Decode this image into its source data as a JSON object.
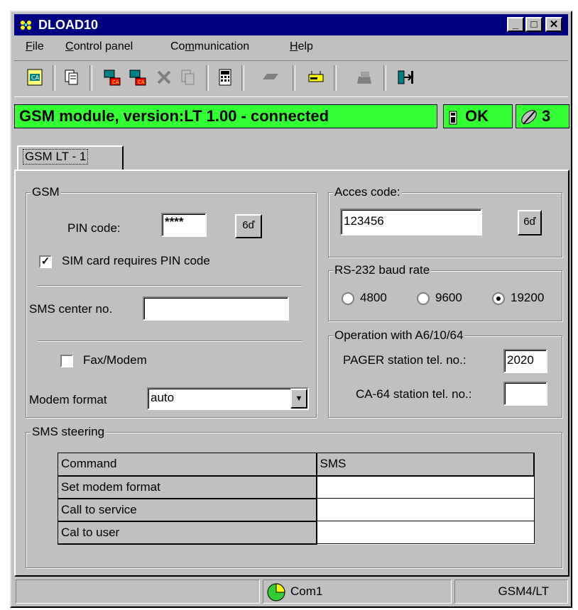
{
  "window": {
    "title": "DLOAD10"
  },
  "title_buttons": {
    "minimize": "_",
    "maximize": "□",
    "close": "✕"
  },
  "menu": [
    {
      "label": "File",
      "hotkey": "F",
      "rest": "ile"
    },
    {
      "label": "Control panel",
      "hotkey": "C",
      "rest": "ontrol panel"
    },
    {
      "label": "Communication",
      "pre": "Co",
      "hotkey": "m",
      "rest": "munication"
    },
    {
      "label": "Help",
      "hotkey": "H",
      "rest": "elp"
    }
  ],
  "status_top": {
    "module_text": "GSM module, version:LT 1.00 -  connected",
    "ok_text": "OK",
    "signal_text": "3",
    "color": "#33ff33"
  },
  "tab": {
    "label": "GSM LT - 1"
  },
  "gsm_group": {
    "legend": "GSM",
    "pin_label": "PIN code:",
    "pin_value": "****",
    "show_button": "6ď",
    "sim_checkbox_label": "SIM card requires PIN code",
    "sim_checked": true,
    "sms_center_label": "SMS center no.",
    "sms_center_value": "",
    "fax_label": "Fax/Modem",
    "fax_checked": false,
    "modem_format_label": "Modem format",
    "modem_format_value": "auto"
  },
  "access_group": {
    "legend": "Acces code:",
    "value": "123456",
    "show_button": "6ď"
  },
  "baud_group": {
    "legend": "RS-232 baud rate",
    "options": [
      "4800",
      "9600",
      "19200"
    ],
    "selected": "19200"
  },
  "operation_group": {
    "legend": "Operation with A6/10/64",
    "pager_label": "PAGER station tel. no.:",
    "pager_value": "2020",
    "ca64_label": "CA-64 station tel. no.:",
    "ca64_value": ""
  },
  "sms_steering": {
    "legend": "SMS steering",
    "headers": [
      "Command",
      "SMS"
    ],
    "rows": [
      {
        "command": "Set modem format",
        "sms": ""
      },
      {
        "command": "Call to service",
        "sms": ""
      },
      {
        "command": "Cal to user",
        "sms": ""
      }
    ]
  },
  "statusbar": {
    "port": "Com1",
    "device": "GSM4/LT"
  }
}
